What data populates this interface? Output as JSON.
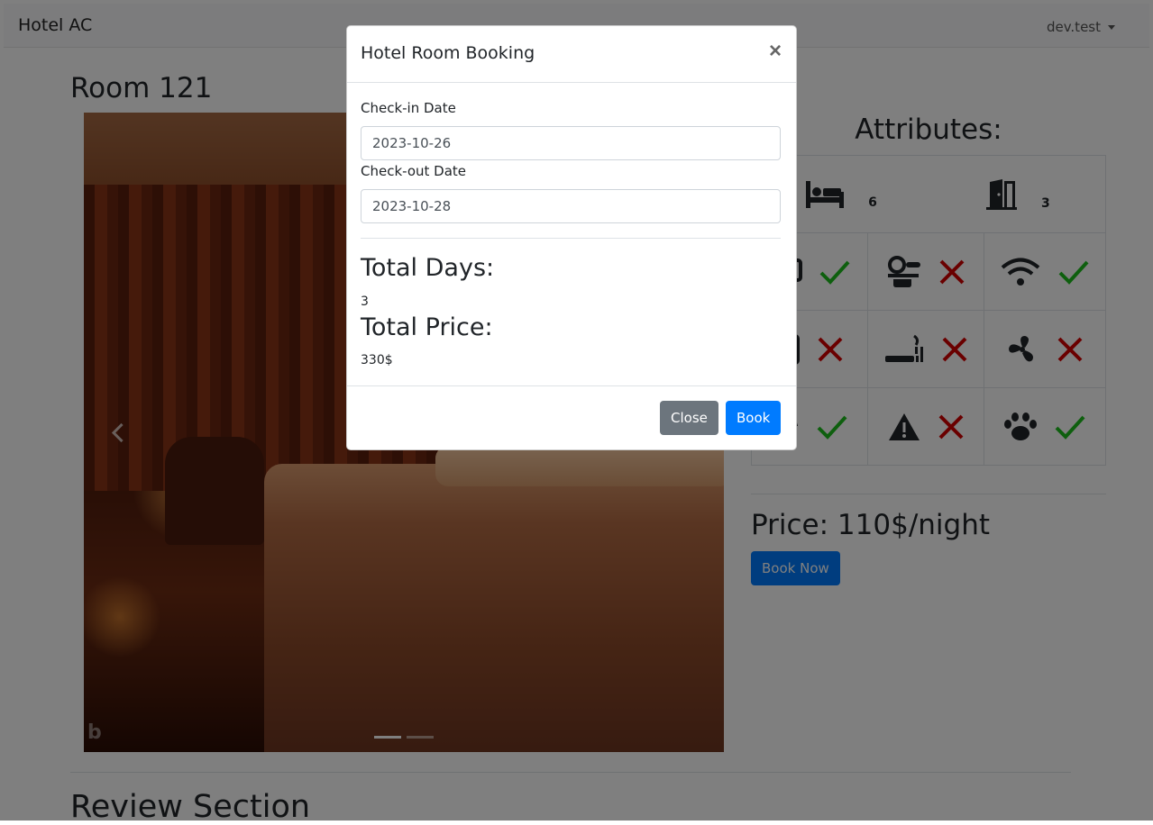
{
  "navbar": {
    "brand": "Hotel AC",
    "user": "dev.test"
  },
  "room": {
    "title": "Room 121"
  },
  "attributes": {
    "title": "Attributes:",
    "rows": [
      [
        {
          "icon": "bed-icon",
          "value": "6"
        },
        {
          "icon": "door-icon",
          "value": "3"
        }
      ],
      [
        {
          "icon": "tv-icon",
          "available": true
        },
        {
          "icon": "coffee-machine-icon",
          "available": false
        },
        {
          "icon": "wifi-icon",
          "available": true
        }
      ],
      [
        {
          "icon": "phone-icon",
          "available": false
        },
        {
          "icon": "smoking-icon",
          "available": false
        },
        {
          "icon": "fan-icon",
          "available": false
        }
      ],
      [
        {
          "icon": "lamp-icon",
          "available": true
        },
        {
          "icon": "warning-icon",
          "available": false
        },
        {
          "icon": "paw-icon",
          "available": true
        }
      ]
    ]
  },
  "price": {
    "text": "Price: 110$/night",
    "book_now": "Book Now"
  },
  "review": {
    "title": "Review Section"
  },
  "modal": {
    "title": "Hotel Room Booking",
    "close_symbol": "×",
    "checkin_label": "Check-in Date",
    "checkin_value": "2023-10-26",
    "checkout_label": "Check-out Date",
    "checkout_value": "2023-10-28",
    "total_days_label": "Total Days:",
    "total_days_value": "3",
    "total_price_label": "Total Price:",
    "total_price_value": "330$",
    "close_button": "Close",
    "book_button": "Book"
  },
  "colors": {
    "primary": "#007bff",
    "secondary": "#6c757d",
    "check": "#1dbf1d",
    "cross": "#d40000"
  }
}
